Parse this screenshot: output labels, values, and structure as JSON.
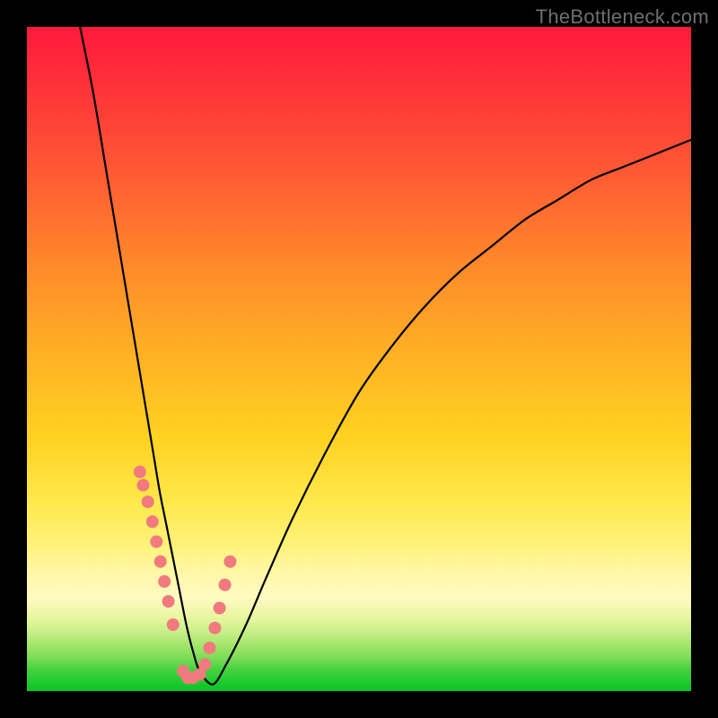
{
  "watermark": "TheBottleneck.com",
  "chart_data": {
    "type": "line",
    "title": "",
    "xlabel": "",
    "ylabel": "",
    "xlim": [
      0,
      100
    ],
    "ylim": [
      0,
      100
    ],
    "grid": false,
    "series": [
      {
        "name": "bottleneck-curve",
        "x": [
          8,
          10,
          12,
          14,
          16,
          18,
          19,
          20,
          21,
          22,
          23,
          24,
          25,
          26,
          28,
          30,
          33,
          36,
          40,
          45,
          50,
          55,
          60,
          65,
          70,
          75,
          80,
          85,
          90,
          95,
          100
        ],
        "values": [
          100,
          90,
          78,
          66,
          54,
          42,
          36,
          30,
          25,
          20,
          15,
          10,
          6,
          3,
          1,
          4,
          10,
          17,
          26,
          36,
          45,
          52,
          58,
          63,
          67,
          71,
          74,
          77,
          79,
          81,
          83
        ]
      }
    ],
    "markers": {
      "name": "data-points",
      "color": "#f07a7e",
      "x": [
        17.0,
        17.5,
        18.2,
        18.9,
        19.5,
        20.1,
        20.7,
        21.3,
        22.0,
        23.5,
        24.2,
        25.0,
        26.0,
        26.8,
        27.5,
        28.3,
        29.0,
        29.8,
        30.6
      ],
      "values": [
        33.0,
        31.0,
        28.5,
        25.5,
        22.5,
        19.5,
        16.5,
        13.5,
        10.0,
        3.0,
        2.0,
        2.0,
        2.5,
        4.0,
        6.5,
        9.5,
        12.5,
        16.0,
        19.5
      ]
    }
  }
}
